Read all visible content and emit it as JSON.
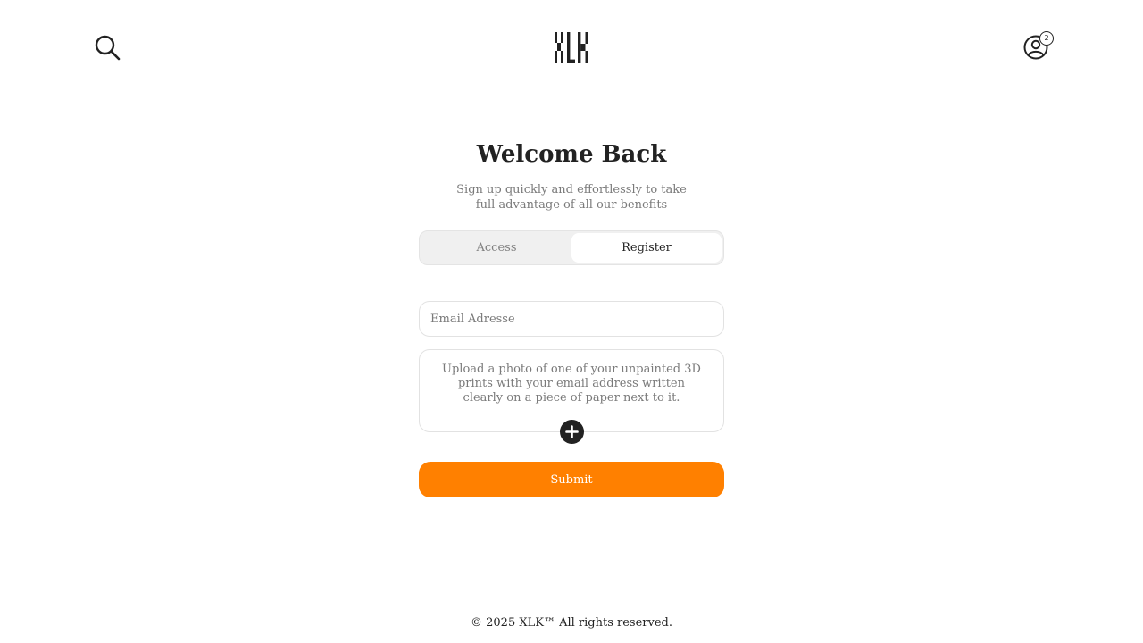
{
  "header": {
    "search_icon": "search-icon",
    "logo_text": "XLK",
    "account_icon": "user-circle-icon",
    "notification_count": "2"
  },
  "login": {
    "title": "Welcome Back",
    "subtitle": "Sign up quickly and effortlessly to take full advantage of all our benefits",
    "tabs": [
      {
        "label": "Access",
        "active": false
      },
      {
        "label": "Register",
        "active": true
      }
    ],
    "email": {
      "placeholder": "Email Adresse",
      "value": ""
    },
    "upload": {
      "instructions": "Upload a photo of one of your unpainted 3D prints with your email address written clearly on a piece of paper next to it.",
      "icon": "plus-icon"
    },
    "submit_label": "Submit"
  },
  "footer": {
    "copyright": "© 2025 XLK™ All rights reserved."
  },
  "colors": {
    "accent": "#ff8000",
    "text": "#222222",
    "muted": "#7a7a7a",
    "border": "#e2e2e2",
    "tab_bg": "#f0f0f0"
  }
}
